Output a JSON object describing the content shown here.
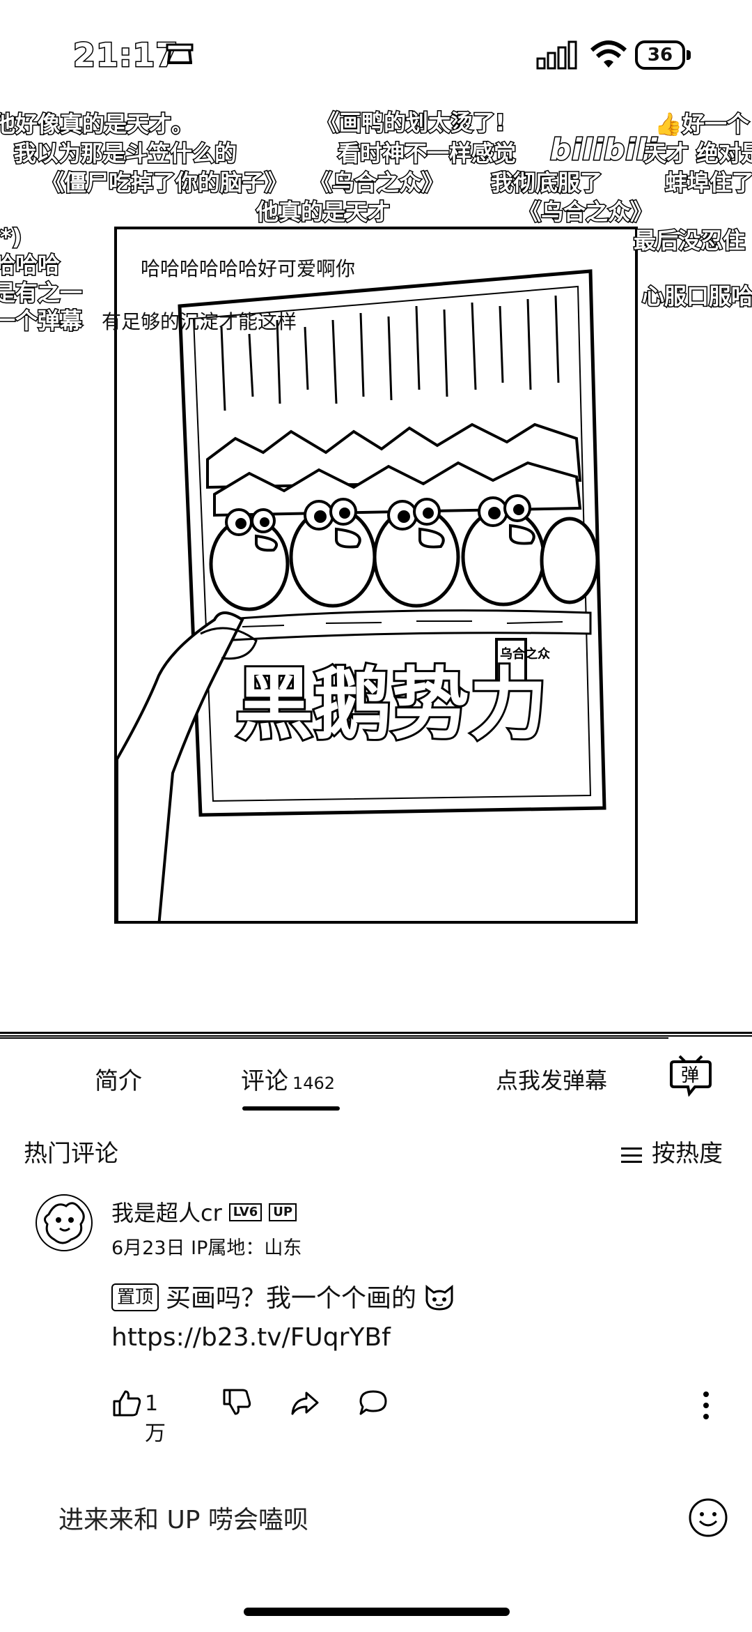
{
  "status_bar": {
    "time": "21:17",
    "battery": "36"
  },
  "danmaku": {
    "row1": [
      "他好像真的是天才。",
      "《画鸭的划太烫了!",
      "好一个",
      "我以为那是斗笠什么的",
      "看时神不一样感觉",
      "天才 绝对是",
      "《僵尸吃掉了你的脑子》",
      "《乌合之众》",
      "我彻底服了",
      "蚌埠住了",
      "他真的是天才",
      "《乌合之众》"
    ],
    "row2": [
      "*)",
      "哈哈哈",
      "是有之一",
      "一个弹幕",
      "有足够的沉淀才能这样",
      "最后没忍住",
      "心服口服哈",
      "哈哈哈哈哈哈好可爱啊你"
    ],
    "logo": "bilibili"
  },
  "video": {
    "drawing_title": "黑鹅势力",
    "drawing_subtitle": "乌合之众"
  },
  "tabs": {
    "intro": "简介",
    "comments": "评论",
    "comments_count": "1462",
    "send_danmaku": "点我发弹幕",
    "danmaku_icon_label": "弹"
  },
  "comments_header": {
    "title": "热门评论",
    "sort": "按热度"
  },
  "comment": {
    "username": "我是超人cr",
    "level_badge": "LV6",
    "up_badge": "UP",
    "meta": "6月23日  IP属地：山东",
    "pinned": "置顶",
    "text": "买画吗？我一个个画的",
    "link": "https://b23.tv/FUqrYBf",
    "likes": "1万"
  },
  "reply_input": {
    "placeholder": "进来来和 UP 唠会嗑呗"
  },
  "icons": [
    "phone-icon",
    "signal-icon",
    "wifi-icon",
    "battery-icon",
    "danmaku-icon",
    "sort-icon",
    "avatar",
    "cat-emoji-icon",
    "like-icon",
    "dislike-icon",
    "share-icon",
    "reply-icon",
    "more-icon",
    "emoji-icon"
  ]
}
